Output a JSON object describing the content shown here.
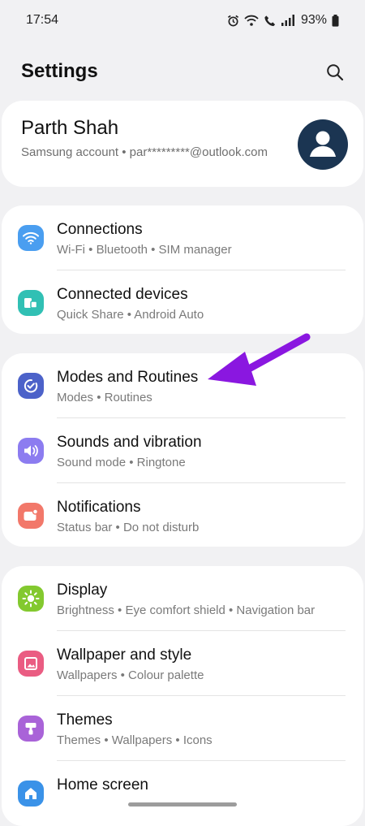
{
  "status": {
    "time": "17:54",
    "battery": "93%"
  },
  "header": {
    "title": "Settings"
  },
  "profile": {
    "name": "Parth Shah",
    "subtitle": "Samsung account  •  par*********@outlook.com"
  },
  "groups": [
    {
      "items": [
        {
          "title": "Connections",
          "subtitle": "Wi-Fi  •  Bluetooth  •  SIM manager",
          "icon": "wifi-icon",
          "color": "#4a9ef0"
        },
        {
          "title": "Connected devices",
          "subtitle": "Quick Share  •  Android Auto",
          "icon": "connected-devices-icon",
          "color": "#31c0b4"
        }
      ]
    },
    {
      "items": [
        {
          "title": "Modes and Routines",
          "subtitle": "Modes  •  Routines",
          "icon": "modes-routines-icon",
          "color": "#4c62c9"
        },
        {
          "title": "Sounds and vibration",
          "subtitle": "Sound mode  •  Ringtone",
          "icon": "speaker-icon",
          "color": "#8c7cf0"
        },
        {
          "title": "Notifications",
          "subtitle": "Status bar  •  Do not disturb",
          "icon": "notification-icon",
          "color": "#f2786a"
        }
      ]
    },
    {
      "items": [
        {
          "title": "Display",
          "subtitle": "Brightness  •  Eye comfort shield  •  Navigation bar",
          "icon": "sun-icon",
          "color": "#83c92f"
        },
        {
          "title": "Wallpaper and style",
          "subtitle": "Wallpapers  •  Colour palette",
          "icon": "wallpaper-icon",
          "color": "#ea5c82"
        },
        {
          "title": "Themes",
          "subtitle": "Themes  •  Wallpapers  •  Icons",
          "icon": "themes-icon",
          "color": "#a963d8"
        },
        {
          "title": "Home screen",
          "subtitle": "",
          "icon": "home-icon",
          "color": "#3a92e8"
        }
      ]
    }
  ],
  "annotation": {
    "arrow_color": "#8a17e0"
  }
}
